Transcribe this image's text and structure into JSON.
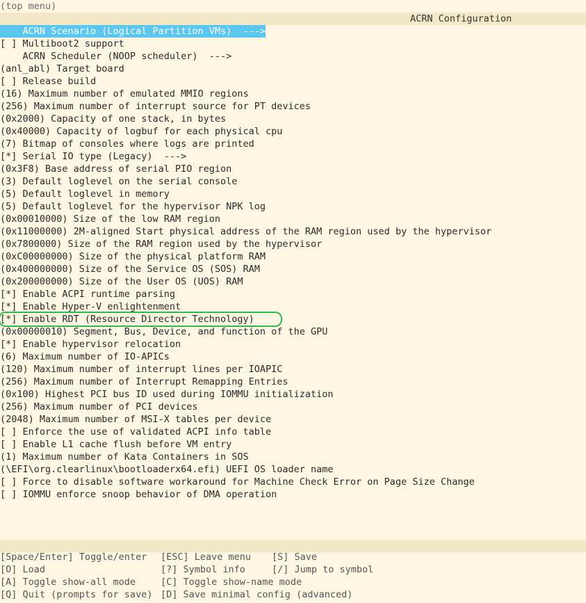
{
  "top_menu": "(top menu)",
  "title": "ACRN Configuration",
  "menu_items": [
    {
      "text": "    ACRN Scenario (Logical Partition VMs)  --->"
    },
    {
      "text": "[ ] Multiboot2 support"
    },
    {
      "text": "    ACRN Scheduler (NOOP scheduler)  --->"
    },
    {
      "text": "(anl_abl) Target board"
    },
    {
      "text": "[ ] Release build"
    },
    {
      "text": "(16) Maximum number of emulated MMIO regions"
    },
    {
      "text": "(256) Maximum number of interrupt source for PT devices"
    },
    {
      "text": "(0x2000) Capacity of one stack, in bytes"
    },
    {
      "text": "(0x40000) Capacity of logbuf for each physical cpu"
    },
    {
      "text": "(7) Bitmap of consoles where logs are printed"
    },
    {
      "text": "[*] Serial IO type (Legacy)  --->"
    },
    {
      "text": "(0x3F8) Base address of serial PIO region"
    },
    {
      "text": "(3) Default loglevel on the serial console"
    },
    {
      "text": "(5) Default loglevel in memory"
    },
    {
      "text": "(5) Default loglevel for the hypervisor NPK log"
    },
    {
      "text": "(0x00010000) Size of the low RAM region"
    },
    {
      "text": "(0x11000000) 2M-aligned Start physical address of the RAM region used by the hypervisor"
    },
    {
      "text": "(0x7800000) Size of the RAM region used by the hypervisor"
    },
    {
      "text": "(0xC00000000) Size of the physical platform RAM"
    },
    {
      "text": "(0x400000000) Size of the Service OS (SOS) RAM"
    },
    {
      "text": "(0x200000000) Size of the User OS (UOS) RAM"
    },
    {
      "text": "[*] Enable ACPI runtime parsing"
    },
    {
      "text": "[*] Enable Hyper-V enlightenment"
    },
    {
      "text": "[*] Enable RDT (Resource Director Technology)"
    },
    {
      "text": "(0x00000010) Segment, Bus, Device, and function of the GPU"
    },
    {
      "text": "[*] Enable hypervisor relocation"
    },
    {
      "text": "(6) Maximum number of IO-APICs"
    },
    {
      "text": "(120) Maximum number of interrupt lines per IOAPIC"
    },
    {
      "text": "(256) Maximum number of Interrupt Remapping Entries"
    },
    {
      "text": "(0x100) Highest PCI bus ID used during IOMMU initialization"
    },
    {
      "text": "(256) Maximum number of PCI devices"
    },
    {
      "text": "(2048) Maximum number of MSI-X tables per device"
    },
    {
      "text": "[ ] Enforce the use of validated ACPI info table"
    },
    {
      "text": "[ ] Enable L1 cache flush before VM entry"
    },
    {
      "text": "(1) Maximum number of Kata Containers in SOS"
    },
    {
      "text": "(\\EFI\\org.clearlinux\\bootloaderx64.efi) UEFI OS loader name"
    },
    {
      "text": "[ ] Force to disable software workaround for Machine Check Error on Page Size Change"
    },
    {
      "text": "[ ] IOMMU enforce snoop behavior of DMA operation"
    }
  ],
  "help_rows": [
    [
      "[Space/Enter] Toggle/enter",
      "[ESC] Leave menu",
      "[S] Save"
    ],
    [
      "[O] Load",
      "[?] Symbol info",
      "[/] Jump to symbol"
    ],
    [
      "[A] Toggle show-all mode",
      "[C] Toggle show-name mode",
      ""
    ],
    [
      "[Q] Quit (prompts for save)",
      "[D] Save minimal config (advanced)",
      ""
    ]
  ],
  "colors": {
    "background": "#fdf6e3",
    "selection": "#5bc7ee",
    "highlight_outline": "#2fb84f",
    "bar": "#f1e8c8"
  }
}
